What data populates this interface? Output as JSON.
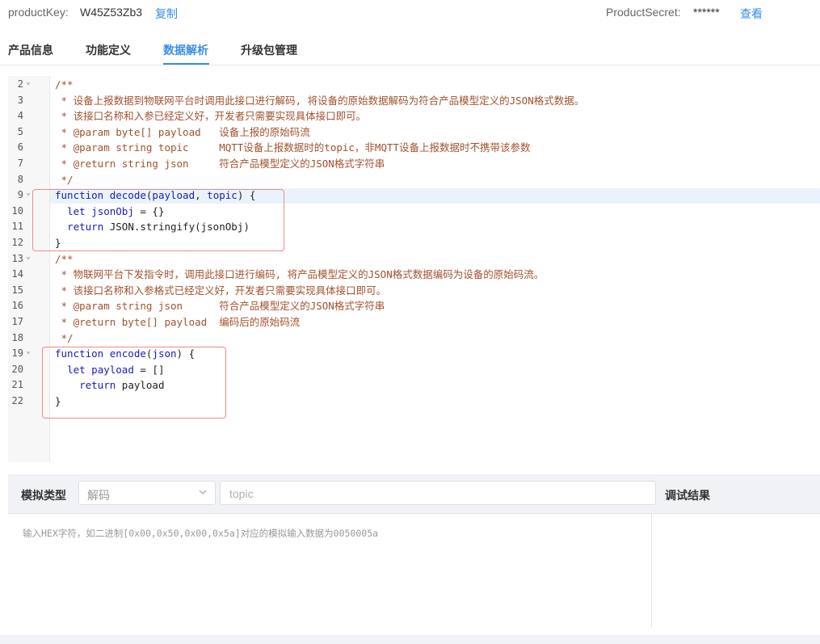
{
  "header": {
    "product_key_label": "productKey:",
    "product_key_value": "W45Z53Zb3",
    "copy_label": "复制",
    "product_secret_label": "ProductSecret:",
    "product_secret_value": "******",
    "view_label": "查看"
  },
  "tabs": [
    {
      "label": "产品信息",
      "active": false
    },
    {
      "label": "功能定义",
      "active": false
    },
    {
      "label": "数据解析",
      "active": true
    },
    {
      "label": "升级包管理",
      "active": false
    }
  ],
  "colors": {
    "accent": "#3a8ee6",
    "highlight_box": "#f08a8a"
  },
  "editor": {
    "lines": [
      {
        "n": "2",
        "fold": true,
        "tokens": [
          [
            "cm",
            "/**"
          ]
        ]
      },
      {
        "n": "3",
        "tokens": [
          [
            "cm",
            " * 设备上报数据到物联网平台时调用此接口进行解码, 将设备的原始数据解码为符合产品模型定义的JSON格式数据。"
          ]
        ]
      },
      {
        "n": "4",
        "tokens": [
          [
            "cm",
            " * 该接口名称和入参已经定义好，开发者只需要实现具体接口即可。"
          ]
        ]
      },
      {
        "n": "5",
        "tokens": [
          [
            "cm",
            " * @param byte[] payload   设备上报的原始码流"
          ]
        ]
      },
      {
        "n": "6",
        "tokens": [
          [
            "cm",
            " * @param string topic     MQTT设备上报数据时的topic，非MQTT设备上报数据时不携带该参数"
          ]
        ]
      },
      {
        "n": "7",
        "tokens": [
          [
            "cm",
            " * @return string json     符合产品模型定义的JSON格式字符串"
          ]
        ]
      },
      {
        "n": "8",
        "tokens": [
          [
            "cm",
            " */"
          ]
        ]
      },
      {
        "n": "9",
        "fold": true,
        "tokens": [
          [
            "kw",
            "function "
          ],
          [
            "fn",
            "decode"
          ],
          [
            "tx",
            "("
          ],
          [
            "kw",
            "payload"
          ],
          [
            "tx",
            ", "
          ],
          [
            "kw",
            "topic"
          ],
          [
            "tx",
            ") {"
          ]
        ]
      },
      {
        "n": "10",
        "tokens": [
          [
            "tx",
            "  "
          ],
          [
            "kw",
            "let "
          ],
          [
            "kw",
            "jsonObj"
          ],
          [
            "tx",
            " = {}"
          ]
        ]
      },
      {
        "n": "11",
        "tokens": [
          [
            "tx",
            "  "
          ],
          [
            "kw",
            "return "
          ],
          [
            "tx",
            "JSON.stringify(jsonObj)"
          ]
        ]
      },
      {
        "n": "12",
        "tokens": [
          [
            "tx",
            "}"
          ]
        ]
      },
      {
        "n": "13",
        "fold": true,
        "tokens": [
          [
            "cm",
            "/**"
          ]
        ]
      },
      {
        "n": "14",
        "tokens": [
          [
            "cm",
            " * 物联网平台下发指令时，调用此接口进行编码, 将产品模型定义的JSON格式数据编码为设备的原始码流。"
          ]
        ]
      },
      {
        "n": "15",
        "tokens": [
          [
            "cm",
            " * 该接口名称和入参格式已经定义好，开发者只需要实现具体接口即可。"
          ]
        ]
      },
      {
        "n": "16",
        "tokens": [
          [
            "cm",
            " * @param string json      符合产品模型定义的JSON格式字符串"
          ]
        ]
      },
      {
        "n": "17",
        "tokens": [
          [
            "cm",
            " * @return byte[] payload  编码后的原始码流"
          ]
        ]
      },
      {
        "n": "18",
        "tokens": [
          [
            "cm",
            " */"
          ]
        ]
      },
      {
        "n": "19",
        "fold": true,
        "tokens": [
          [
            "kw",
            "function "
          ],
          [
            "fn",
            "encode"
          ],
          [
            "tx",
            "("
          ],
          [
            "kw",
            "json"
          ],
          [
            "tx",
            ") {"
          ]
        ]
      },
      {
        "n": "20",
        "tokens": [
          [
            "tx",
            "  "
          ],
          [
            "kw",
            "let "
          ],
          [
            "kw",
            "payload"
          ],
          [
            "tx",
            " = []"
          ]
        ]
      },
      {
        "n": "21",
        "tokens": [
          [
            "tx",
            "    "
          ],
          [
            "kw",
            "return "
          ],
          [
            "tx",
            "payload"
          ]
        ]
      },
      {
        "n": "22",
        "tokens": [
          [
            "tx",
            "}"
          ]
        ]
      }
    ]
  },
  "simulate": {
    "type_label": "模拟类型",
    "type_value": "解码",
    "topic_placeholder": "topic",
    "result_label": "调试结果",
    "input_placeholder": "输入HEX字符，如二进制[0x00,0x50,0x00,0x5a]对应的模拟输入数据为0050005a"
  }
}
